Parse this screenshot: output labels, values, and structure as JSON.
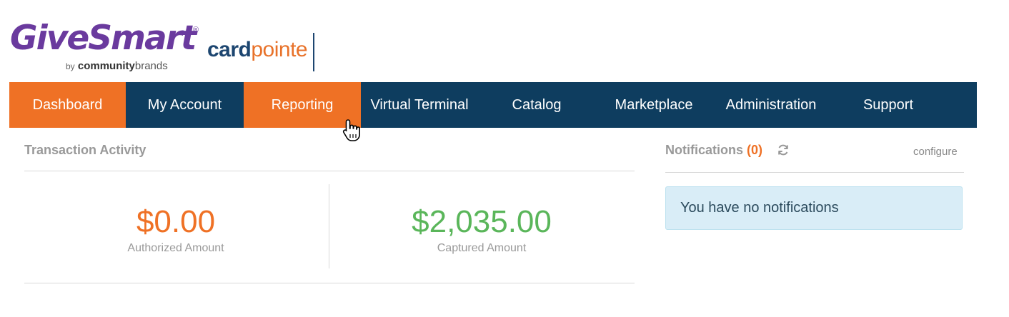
{
  "header": {
    "brand_name": "GiveSmart",
    "brand_registered": "®",
    "byline_by": "by",
    "byline_community": "community",
    "byline_brands": "brands",
    "partner_card": "card",
    "partner_pointe": "pointe"
  },
  "nav": {
    "items": [
      {
        "label": "Dashboard",
        "active": true
      },
      {
        "label": "My Account",
        "active": false
      },
      {
        "label": "Reporting",
        "active": true
      },
      {
        "label": "Virtual Terminal",
        "active": false
      },
      {
        "label": "Catalog",
        "active": false
      },
      {
        "label": "Marketplace",
        "active": false
      },
      {
        "label": "Administration",
        "active": false
      },
      {
        "label": "Support",
        "active": false
      }
    ]
  },
  "transaction_activity": {
    "title": "Transaction Activity",
    "authorized_amount": "$0.00",
    "authorized_label": "Authorized Amount",
    "captured_amount": "$2,035.00",
    "captured_label": "Captured Amount"
  },
  "notifications": {
    "title": "Notifications",
    "count": "(0)",
    "configure_label": "configure",
    "empty_message": "You have no notifications"
  },
  "colors": {
    "brand_purple": "#6a3a9e",
    "nav_background": "#0e3d5f",
    "nav_active": "#ef7125",
    "authorized_amount": "#ef7125",
    "captured_amount": "#5ab65a",
    "notification_box": "#d9edf7"
  },
  "icons": {
    "refresh": "refresh-icon",
    "cursor": "hand-pointer-icon"
  }
}
